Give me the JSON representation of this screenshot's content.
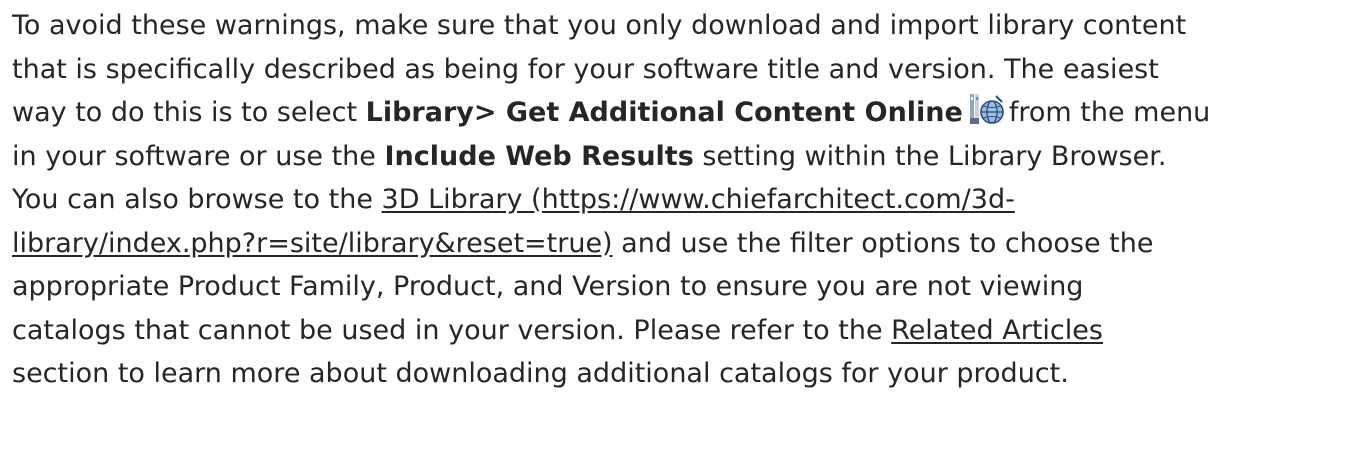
{
  "paragraph": {
    "l1": "To avoid these warnings, make sure that you only download and import library content",
    "l2": "that is specifically described as being for your software title and version. The easiest",
    "l3_a": "way to do this is to select ",
    "l3_bold": "Library> Get Additional Content Online",
    "l3_b": "from the menu",
    "l4_a": "in your software or use the ",
    "l4_bold": "Include Web Results",
    "l4_b": " setting within the Library Browser.",
    "l5_a": "You can also browse to the ",
    "link_3d_library_part1": "3D Library (https://www.chiefarchitect.com/3d-",
    "link_3d_library_part2": "library/index.php?r=site/library&reset=true)",
    "l6_b": " and use the filter options to choose the",
    "l7": "appropriate Product Family, Product, and Version to ensure you are not viewing",
    "l8_a": "catalogs that cannot be used in your version. Please refer to the ",
    "link_related_articles": "Related Articles",
    "l9": "section to learn more about downloading additional catalogs for your product.",
    "icon": "library-globe-icon"
  }
}
